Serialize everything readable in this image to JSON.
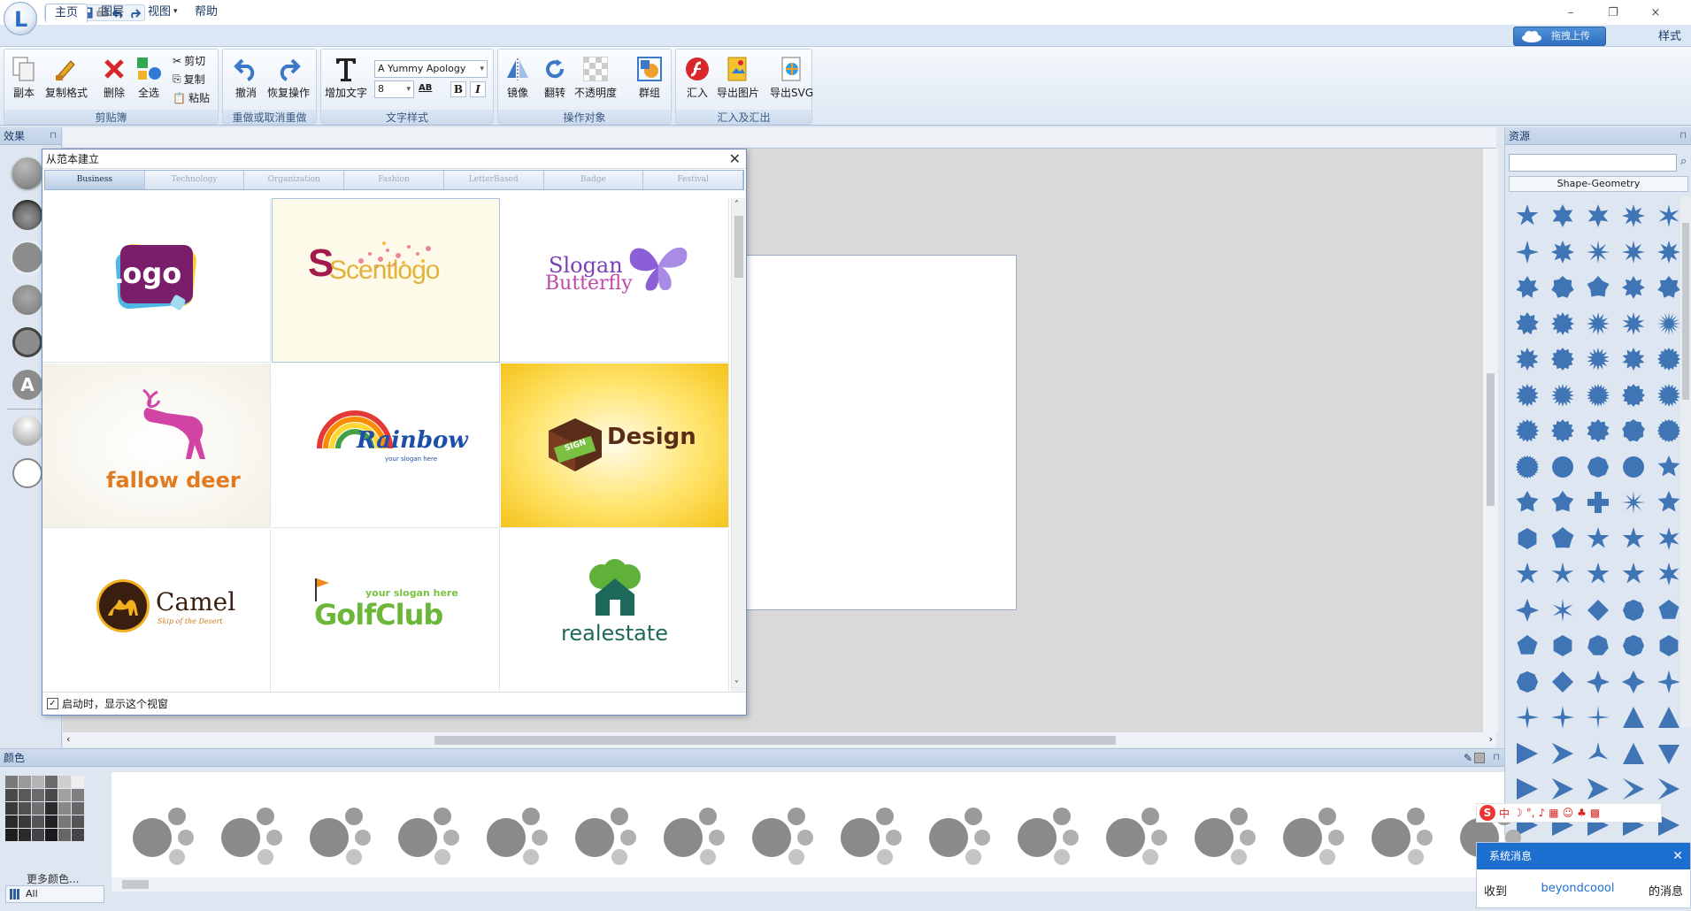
{
  "window": {
    "minimize": "–",
    "restore": "❐",
    "close": "×"
  },
  "menu": {
    "tabs": [
      "主页",
      "图层",
      "视图",
      "帮助"
    ],
    "active": 0,
    "upload": "拖拽上传",
    "styles": "样式"
  },
  "ribbon": {
    "clipboard": {
      "label": "剪贴簿",
      "copy": "副本",
      "format_painter": "复制格式",
      "delete": "删除",
      "select_all": "全选",
      "cut": "剪切",
      "copy_small": "复制",
      "paste": "粘贴"
    },
    "undo": {
      "label": "重做或取消重做",
      "undo": "撤消",
      "redo": "恢复操作"
    },
    "text": {
      "label": "文字样式",
      "add_text": "增加文字",
      "font": "A Yummy Apology",
      "size": "8",
      "bold": "B",
      "italic": "I",
      "case": "AB"
    },
    "ops": {
      "label": "操作对象",
      "mirror": "镜像",
      "flip": "翻转",
      "opacity": "不透明度",
      "group": "群组"
    },
    "io": {
      "label": "汇入及汇出",
      "import": "汇入",
      "export_image": "导出图片",
      "export_svg": "导出SVG"
    }
  },
  "effects": {
    "title": "效果"
  },
  "dialog": {
    "title": "从范本建立",
    "tabs": [
      "Business",
      "Technology",
      "Organization",
      "Fashion",
      "LetterBased",
      "Badge",
      "Festival"
    ],
    "active_tab": 0,
    "templates": [
      {
        "name": "Logo"
      },
      {
        "name": "Scentlogo"
      },
      {
        "name": "Slogan Butterfly",
        "line1": "Slogan",
        "line2": "Butterfly"
      },
      {
        "name": "fallow deer"
      },
      {
        "name": "Rainbow",
        "slogan": "your slogan here"
      },
      {
        "name": "Design",
        "badge": "SIGN"
      },
      {
        "name": "Camel",
        "sub": "Skip of the Desert"
      },
      {
        "name": "GolfClub",
        "slogan": "your slogan here",
        "word": "GolfClub"
      },
      {
        "name": "realestate"
      }
    ],
    "footer": "启动时，显示这个视窗"
  },
  "resources": {
    "title": "资源",
    "search_placeholder": "",
    "category": "Shape-Geometry"
  },
  "colors": {
    "title": "颜色",
    "more": "更多颜色...",
    "filter": "All"
  },
  "ime": {
    "label": "中"
  },
  "sysmsg": {
    "title": "系统消息",
    "left": "收到",
    "link": "beyondcoool",
    "right": "的消息"
  }
}
